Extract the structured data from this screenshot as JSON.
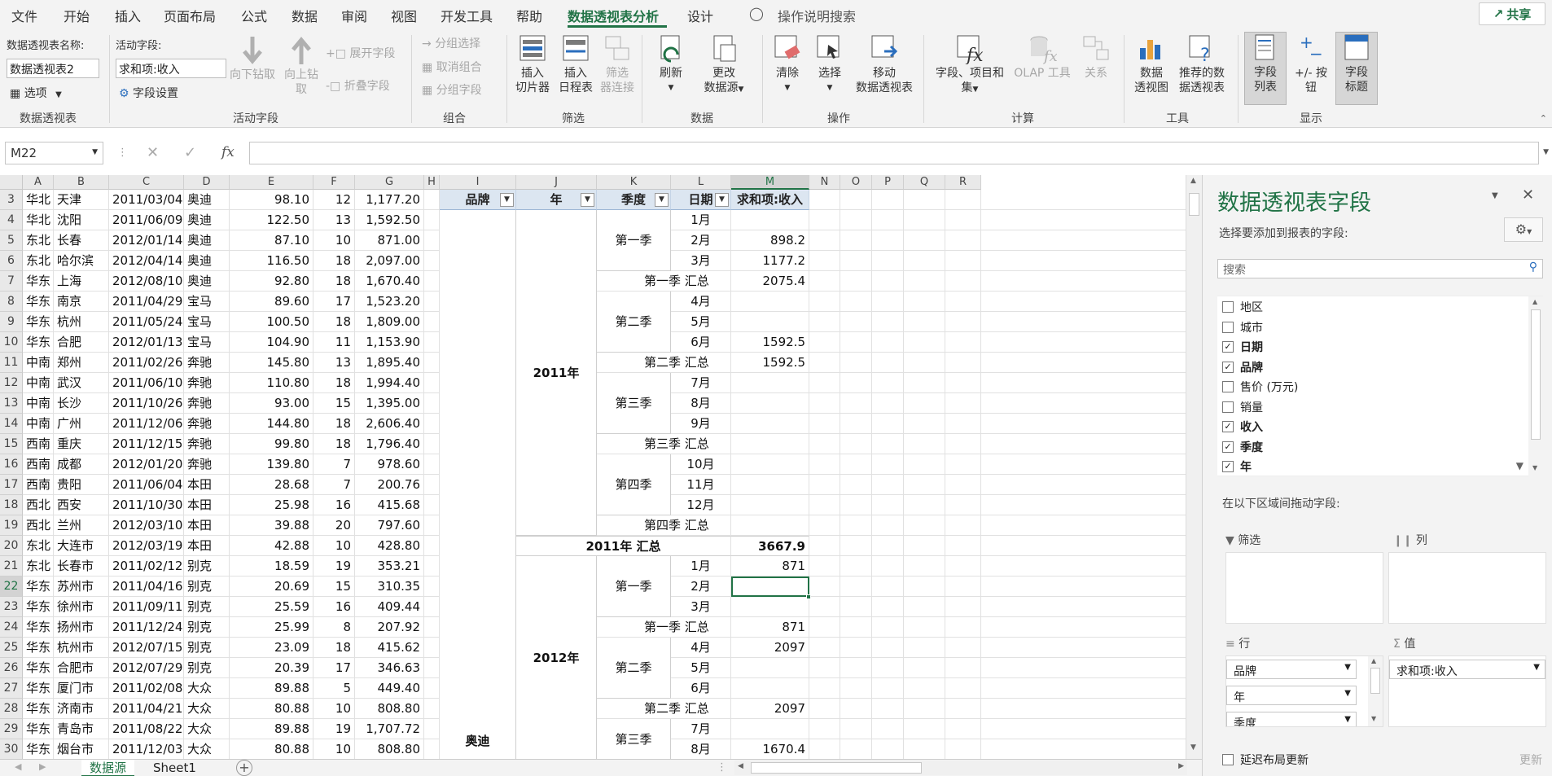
{
  "menu": {
    "tabs": [
      "文件",
      "开始",
      "插入",
      "页面布局",
      "公式",
      "数据",
      "审阅",
      "视图",
      "开发工具",
      "帮助",
      "数据透视表分析",
      "设计"
    ],
    "active_index": 10,
    "search_label": "操作说明搜索",
    "share_label": "共享"
  },
  "ribbon": {
    "pivot_name_label": "数据透视表名称:",
    "pivot_name_value": "数据透视表2",
    "options_label": "选项",
    "active_field_label": "活动字段:",
    "active_field_value": "求和项:收入",
    "field_settings_label": "字段设置",
    "drill_down_label": "向下钻取",
    "drill_up_label": "向上钻",
    "drill_up_label2": "取",
    "expand_field_label": "展开字段",
    "collapse_field_label": "折叠字段",
    "group_selection_label": "分组选择",
    "ungroup_label": "取消组合",
    "group_field_label": "分组字段",
    "insert_slicer_label": [
      "插入",
      "切片器"
    ],
    "insert_timeline_label": [
      "插入",
      "日程表"
    ],
    "filter_connections_label": [
      "筛选",
      "器连接"
    ],
    "refresh_label": "刷新",
    "change_source_label": [
      "更改",
      "数据源"
    ],
    "clear_label": "清除",
    "select_label": "选择",
    "move_pivot_label": [
      "移动",
      "数据透视表"
    ],
    "fields_items_label": [
      "字段、项目和",
      "集"
    ],
    "olap_tools_label": "OLAP 工具",
    "relationships_label": "关系",
    "pivot_chart_label": [
      "数据",
      "透视图"
    ],
    "recommended_label": [
      "推荐的数",
      "据透视表"
    ],
    "field_list_label": [
      "字段",
      "列表"
    ],
    "buttons_label": "+/- 按钮",
    "field_headers_label": [
      "字段",
      "标题"
    ],
    "groups": [
      "数据透视表",
      "活动字段",
      "组合",
      "筛选",
      "数据",
      "操作",
      "计算",
      "工具",
      "显示"
    ]
  },
  "formula_bar": {
    "name_box": "M22",
    "formula": ""
  },
  "columns": [
    "A",
    "B",
    "C",
    "D",
    "E",
    "F",
    "G",
    "H",
    "I",
    "J",
    "K",
    "L",
    "M",
    "N",
    "O",
    "P",
    "Q",
    "R"
  ],
  "rows": [
    "3",
    "4",
    "5",
    "6",
    "7",
    "8",
    "9",
    "10",
    "11",
    "12",
    "13",
    "14",
    "15",
    "16",
    "17",
    "18",
    "19",
    "20",
    "21",
    "22",
    "23",
    "24",
    "25",
    "26",
    "27",
    "28",
    "29",
    "30"
  ],
  "source_data": [
    [
      "华北",
      "天津",
      "2011/03/04",
      "奥迪",
      "98.10",
      "12",
      "1,177.20"
    ],
    [
      "华北",
      "沈阳",
      "2011/06/09",
      "奥迪",
      "122.50",
      "13",
      "1,592.50"
    ],
    [
      "东北",
      "长春",
      "2012/01/14",
      "奥迪",
      "87.10",
      "10",
      "871.00"
    ],
    [
      "东北",
      "哈尔滨",
      "2012/04/14",
      "奥迪",
      "116.50",
      "18",
      "2,097.00"
    ],
    [
      "华东",
      "上海",
      "2012/08/10",
      "奥迪",
      "92.80",
      "18",
      "1,670.40"
    ],
    [
      "华东",
      "南京",
      "2011/04/29",
      "宝马",
      "89.60",
      "17",
      "1,523.20"
    ],
    [
      "华东",
      "杭州",
      "2011/05/24",
      "宝马",
      "100.50",
      "18",
      "1,809.00"
    ],
    [
      "华东",
      "合肥",
      "2012/01/13",
      "宝马",
      "104.90",
      "11",
      "1,153.90"
    ],
    [
      "中南",
      "郑州",
      "2011/02/26",
      "奔驰",
      "145.80",
      "13",
      "1,895.40"
    ],
    [
      "中南",
      "武汉",
      "2011/06/10",
      "奔驰",
      "110.80",
      "18",
      "1,994.40"
    ],
    [
      "中南",
      "长沙",
      "2011/10/26",
      "奔驰",
      "93.00",
      "15",
      "1,395.00"
    ],
    [
      "中南",
      "广州",
      "2011/12/06",
      "奔驰",
      "144.80",
      "18",
      "2,606.40"
    ],
    [
      "西南",
      "重庆",
      "2011/12/15",
      "奔驰",
      "99.80",
      "18",
      "1,796.40"
    ],
    [
      "西南",
      "成都",
      "2012/01/20",
      "奔驰",
      "139.80",
      "7",
      "978.60"
    ],
    [
      "西南",
      "贵阳",
      "2011/06/04",
      "本田",
      "28.68",
      "7",
      "200.76"
    ],
    [
      "西北",
      "西安",
      "2011/10/30",
      "本田",
      "25.98",
      "16",
      "415.68"
    ],
    [
      "西北",
      "兰州",
      "2012/03/10",
      "本田",
      "39.88",
      "20",
      "797.60"
    ],
    [
      "东北",
      "大连市",
      "2012/03/19",
      "本田",
      "42.88",
      "10",
      "428.80"
    ],
    [
      "东北",
      "长春市",
      "2011/02/12",
      "别克",
      "18.59",
      "19",
      "353.21"
    ],
    [
      "华东",
      "苏州市",
      "2011/04/16",
      "别克",
      "20.69",
      "15",
      "310.35"
    ],
    [
      "华东",
      "徐州市",
      "2011/09/11",
      "别克",
      "25.59",
      "16",
      "409.44"
    ],
    [
      "华东",
      "扬州市",
      "2011/12/24",
      "别克",
      "25.99",
      "8",
      "207.92"
    ],
    [
      "华东",
      "杭州市",
      "2012/07/15",
      "别克",
      "23.09",
      "18",
      "415.62"
    ],
    [
      "华东",
      "合肥市",
      "2012/07/29",
      "别克",
      "20.39",
      "17",
      "346.63"
    ],
    [
      "华东",
      "厦门市",
      "2011/02/08",
      "大众",
      "89.88",
      "5",
      "449.40"
    ],
    [
      "华东",
      "济南市",
      "2011/04/21",
      "大众",
      "80.88",
      "10",
      "808.80"
    ],
    [
      "华东",
      "青岛市",
      "2011/08/22",
      "大众",
      "89.88",
      "19",
      "1,707.72"
    ],
    [
      "华东",
      "烟台市",
      "2011/12/03",
      "大众",
      "80.88",
      "10",
      "808.80"
    ]
  ],
  "pivot": {
    "headers": {
      "brand": "品牌",
      "year": "年",
      "quarter": "季度",
      "date": "日期",
      "sum": "求和项:收入"
    },
    "brand_value": "奥迪",
    "year_2011": "2011年",
    "year_2012": "2012年",
    "rows": [
      {
        "q": "",
        "m": "1月",
        "v": ""
      },
      {
        "q": "第一季",
        "m": "2月",
        "v": "898.2"
      },
      {
        "q": "",
        "m": "3月",
        "v": "1177.2"
      },
      {
        "qt": "第一季 汇总",
        "v": "2075.4"
      },
      {
        "q": "",
        "m": "4月",
        "v": ""
      },
      {
        "q": "第二季",
        "m": "5月",
        "v": ""
      },
      {
        "q": "",
        "m": "6月",
        "v": "1592.5"
      },
      {
        "qt": "第二季 汇总",
        "v": "1592.5"
      },
      {
        "q": "",
        "m": "7月",
        "v": ""
      },
      {
        "q": "第三季",
        "m": "8月",
        "v": ""
      },
      {
        "q": "",
        "m": "9月",
        "v": ""
      },
      {
        "qt": "第三季 汇总",
        "v": ""
      },
      {
        "q": "",
        "m": "10月",
        "v": ""
      },
      {
        "q": "第四季",
        "m": "11月",
        "v": ""
      },
      {
        "q": "",
        "m": "12月",
        "v": ""
      },
      {
        "qt": "第四季 汇总",
        "v": ""
      },
      {
        "yt": "2011年 汇总",
        "v": "3667.9"
      },
      {
        "q": "",
        "m": "1月",
        "v": "871"
      },
      {
        "q": "第一季",
        "m": "2月",
        "v": ""
      },
      {
        "q": "",
        "m": "3月",
        "v": ""
      },
      {
        "qt": "第一季 汇总",
        "v": "871"
      },
      {
        "q": "",
        "m": "4月",
        "v": "2097"
      },
      {
        "q": "第二季",
        "m": "5月",
        "v": ""
      },
      {
        "q": "",
        "m": "6月",
        "v": ""
      },
      {
        "qt": "第二季 汇总",
        "v": "2097"
      },
      {
        "q": "",
        "m": "7月",
        "v": ""
      },
      {
        "q": "第三季",
        "m": "8月",
        "v": "1670.4"
      }
    ]
  },
  "sheets": {
    "tabs": [
      "数据源",
      "Sheet1"
    ],
    "active_index": 0
  },
  "field_panel": {
    "title": "数据透视表字段",
    "choose_label": "选择要添加到报表的字段:",
    "search_placeholder": "搜索",
    "fields": [
      {
        "name": "地区",
        "checked": false
      },
      {
        "name": "城市",
        "checked": false
      },
      {
        "name": "日期",
        "checked": true
      },
      {
        "name": "品牌",
        "checked": true
      },
      {
        "name": "售价 (万元)",
        "checked": false
      },
      {
        "name": "销量",
        "checked": false
      },
      {
        "name": "收入",
        "checked": true
      },
      {
        "name": "季度",
        "checked": true
      },
      {
        "name": "年",
        "checked": true
      }
    ],
    "drag_label": "在以下区域间拖动字段:",
    "filter_label": "筛选",
    "columns_label": "列",
    "rows_label": "行",
    "values_label": "值",
    "row_items": [
      "品牌",
      "年",
      "季度"
    ],
    "value_items": [
      "求和项:收入"
    ],
    "defer_label": "延迟布局更新",
    "update_label": "更新"
  }
}
